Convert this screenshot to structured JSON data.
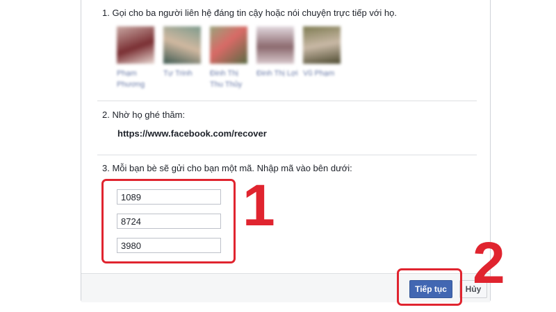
{
  "colors": {
    "primary_button": "#4267b2",
    "annotation_red": "#e0242f",
    "friend_name": "#6a7ba8"
  },
  "steps": {
    "step1": "1. Gọi cho ba người liên hệ đáng tin cậy hoặc nói chuyện trực tiếp với họ.",
    "step2": "2. Nhờ họ ghé thăm:",
    "step3": "3. Mỗi bạn bè sẽ gửi cho bạn một mã. Nhập mã vào bên dưới:"
  },
  "friends": [
    {
      "name": "Phạm Phương",
      "color_a": "#c9a8a3",
      "color_b": "#7a2f33"
    },
    {
      "name": "Tự Trinh",
      "color_a": "#7d9b8d",
      "color_b": "#d0b8a0"
    },
    {
      "name": "Đinh Thị Thu Thủy",
      "color_a": "#9aa37c",
      "color_b": "#d86a66"
    },
    {
      "name": "Đinh Thị Lợi",
      "color_a": "#e2d9df",
      "color_b": "#8c6a6f"
    },
    {
      "name": "Vũ Phạm",
      "color_a": "#7e7b52",
      "color_b": "#c9b9a6"
    }
  ],
  "recover_url": "https://www.facebook.com/recover",
  "codes": [
    "1089",
    "8724",
    "3980"
  ],
  "buttons": {
    "continue": "Tiếp tục",
    "cancel": "Hủy"
  },
  "annotations": {
    "label_1": "1",
    "label_2": "2"
  }
}
